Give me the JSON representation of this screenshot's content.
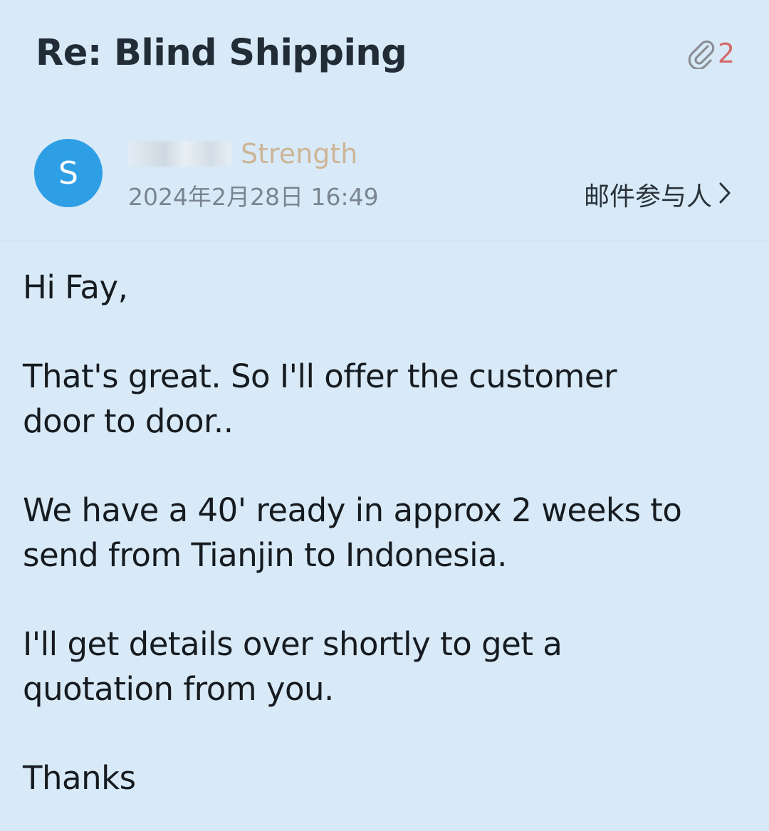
{
  "email": {
    "subject": "Re: Blind Shipping",
    "attachment_count": "2",
    "attachment_icon": "paperclip-icon",
    "sender": {
      "avatar_letter": "S",
      "name": "Strength",
      "timestamp": "2024年2月28日 16:49"
    },
    "participants_label": "邮件参与人",
    "participants_icon": "chevron-right-icon",
    "body": {
      "greeting": "Hi Fay,",
      "paragraph_1": "That's great. So I'll offer the customer\ndoor to door..",
      "paragraph_2": "We have a 40' ready in approx 2 weeks to\nsend from Tianjin to Indonesia.",
      "paragraph_3": "I'll get details over shortly to get a\nquotation from you.",
      "signoff": "Thanks"
    }
  },
  "colors": {
    "background": "#d8eaf8",
    "avatar": "#2f9fe5",
    "attachment_count": "#d46a6a",
    "sender_name": "#ccb596"
  }
}
